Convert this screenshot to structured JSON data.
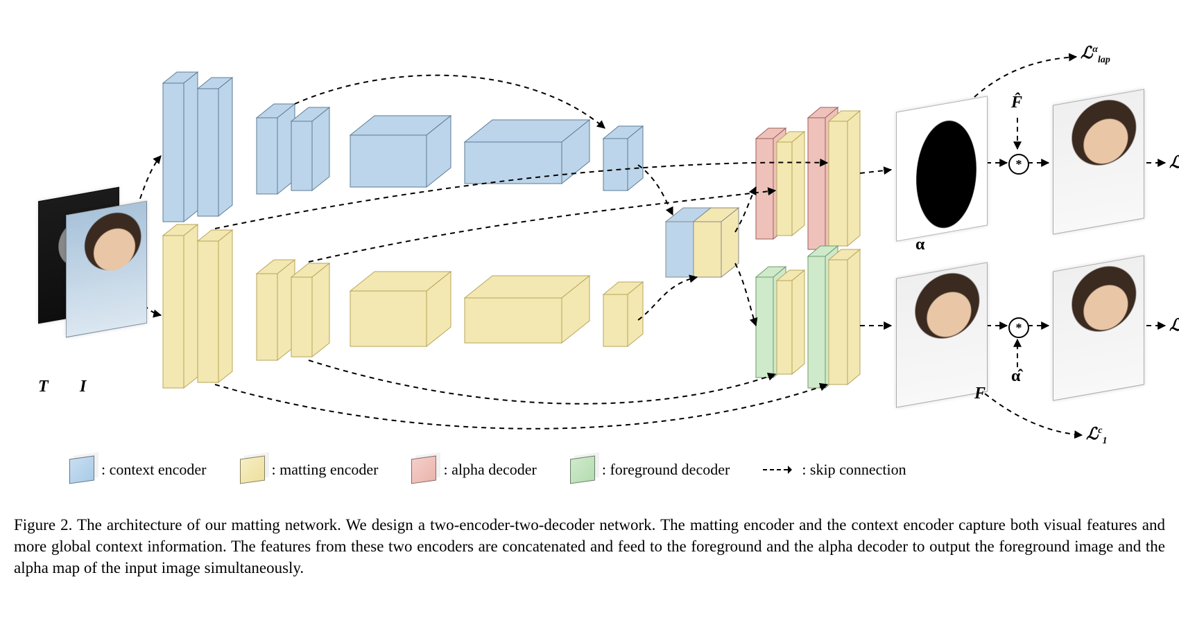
{
  "diagram": {
    "input_labels": {
      "trimap": "T",
      "image": "I"
    },
    "output_labels": {
      "alpha": "α",
      "foreground": "F",
      "F_hat": "F̂",
      "alpha_hat": "α̂"
    },
    "losses": {
      "lap_alpha": "ℒ lap α",
      "F_alpha": "ℒ F α",
      "F_c": "ℒ F c",
      "one_c": "ℒ 1 c"
    },
    "legend": {
      "context_encoder": ": context encoder",
      "matting_encoder": ": matting encoder",
      "alpha_decoder": ": alpha decoder",
      "foreground_decoder": ": foreground decoder",
      "skip_connection": ": skip connection"
    },
    "operators": {
      "multiply": "*"
    }
  },
  "caption": {
    "label": "Figure 2.",
    "text": "The architecture of our matting network. We design a two-encoder-two-decoder network. The matting encoder and the context encoder capture both visual features and more global context information. The features from these two encoders are concatenated and feed to the foreground and the alpha decoder to output the foreground image and the alpha map of the input image simultaneously."
  }
}
